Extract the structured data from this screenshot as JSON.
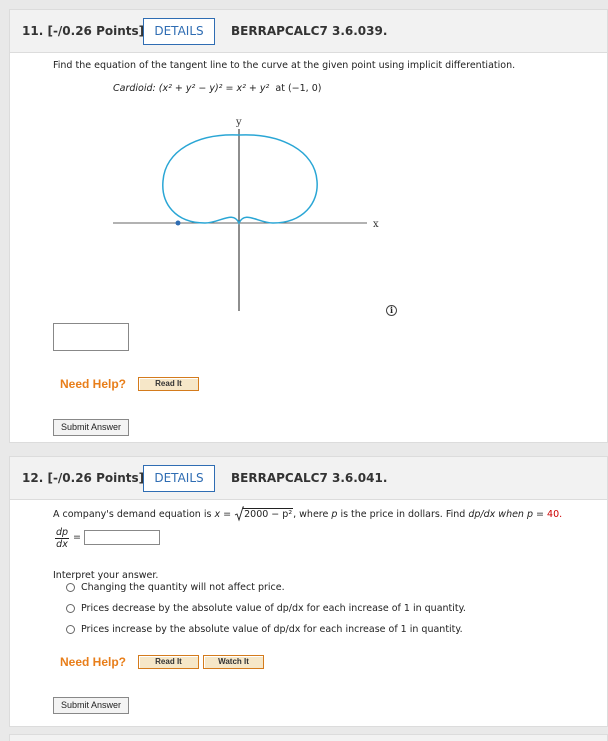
{
  "q11": {
    "number": "11.",
    "points": "[-/0.26 Points]",
    "details_label": "DETAILS",
    "code": "BERRAPCALC7 3.6.039.",
    "prompt": "Find the equation of the tangent line to the curve at the given point using implicit differentiation.",
    "curve_name": "Cardioid:",
    "equation": "(x² + y² − y)² = x² + y²",
    "at_word": "at",
    "point": "(−1, 0)",
    "axis_y": "y",
    "axis_x": "x",
    "need_help": "Need Help?",
    "read_it": "Read It",
    "submit": "Submit Answer",
    "answer_value": ""
  },
  "q12": {
    "number": "12.",
    "points": "[-/0.26 Points]",
    "details_label": "DETAILS",
    "code": "BERRAPCALC7 3.6.041.",
    "prompt_pre": "A company's demand equation is",
    "eq_lhs": "x =",
    "sqrt_body": "2000 − p²",
    "prompt_mid": ", where",
    "p_var": "p",
    "prompt_mid2": "is the price in dollars. Find",
    "dpdx": "dp/dx",
    "prompt_when": "when",
    "p_eq": "p =",
    "p_value": "40.",
    "frac_num": "dp",
    "frac_den": "dx",
    "equals": "=",
    "answer_value": "",
    "interpret": "Interpret your answer.",
    "options": [
      "Changing the quantity will not affect price.",
      "Prices decrease by the absolute value of dp/dx for each increase of 1 in quantity.",
      "Prices increase by the absolute value of dp/dx for each increase of 1 in quantity."
    ],
    "need_help": "Need Help?",
    "read_it": "Read It",
    "watch_it": "Watch It",
    "submit": "Submit Answer"
  },
  "colors": {
    "curve": "#2aa6d5",
    "accent": "#2f6db3",
    "help": "#e87e1a",
    "red": "#cc0000"
  }
}
